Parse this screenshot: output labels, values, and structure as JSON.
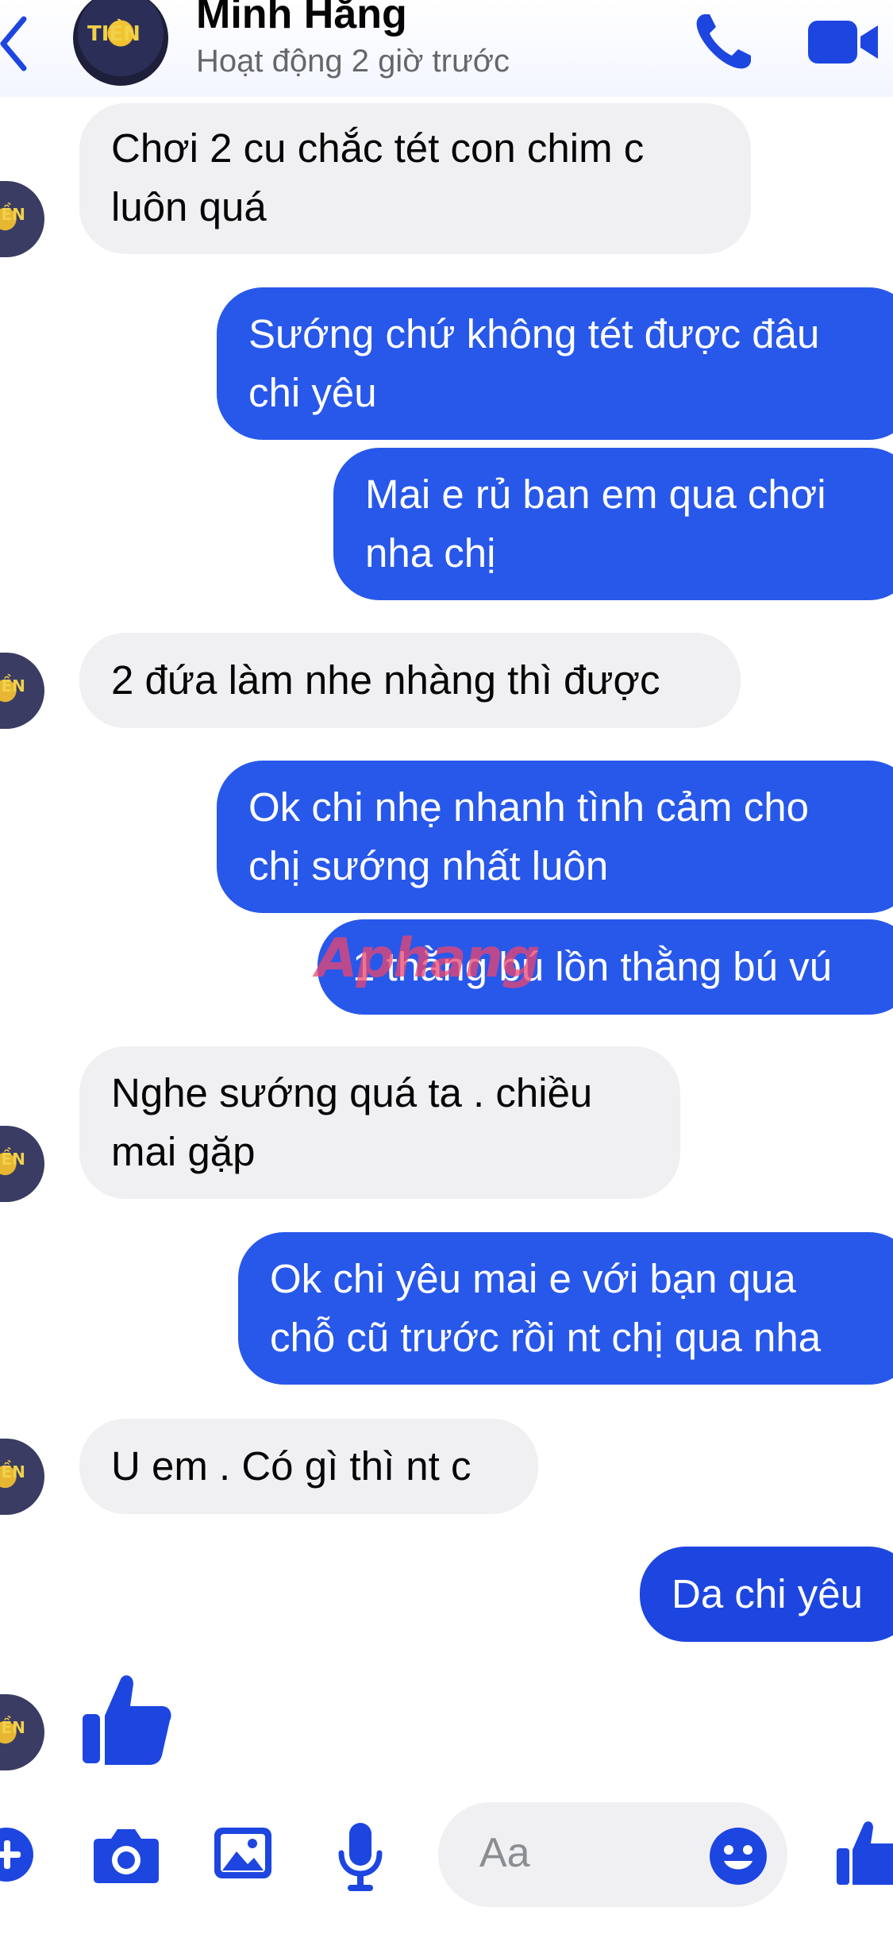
{
  "header": {
    "contact_name": "Minh Hằng",
    "status": "Hoạt động 2 giờ trước",
    "avatar_text": "TIỀN"
  },
  "messages": [
    {
      "dir": "in",
      "lines": [
        "Chơi 2 cu chắc tét con chim c",
        "luôn quá"
      ]
    },
    {
      "dir": "out",
      "lines": [
        "Sướng chứ không tét được đâu",
        "chi yêu"
      ]
    },
    {
      "dir": "out",
      "lines": [
        "Mai e rủ ban em qua chơi",
        "nha chị"
      ]
    },
    {
      "dir": "in",
      "lines": [
        "2 đứa làm nhe nhàng thì được"
      ]
    },
    {
      "dir": "out",
      "lines": [
        "Ok chi nhẹ nhanh tình cảm cho",
        "chị sướng nhất luôn"
      ]
    },
    {
      "dir": "out",
      "lines": [
        "1 thằng bú lồn thằng bú vú"
      ]
    },
    {
      "dir": "in",
      "lines": [
        "Nghe sướng quá ta . chiều",
        "mai gặp"
      ]
    },
    {
      "dir": "out",
      "lines": [
        "Ok chi yêu mai e với bạn qua",
        "chỗ cũ trước rồi nt chị qua nha"
      ]
    },
    {
      "dir": "in",
      "lines": [
        "U em . Có gì thì nt c"
      ]
    },
    {
      "dir": "out",
      "lines": [
        "Da chi yêu"
      ]
    }
  ],
  "watermark": {
    "part1": "Aphang",
    "part2": ""
  },
  "composer": {
    "placeholder": "Aa"
  },
  "icons": {
    "back": "chevron-left-icon",
    "call": "phone-icon",
    "video": "video-camera-icon",
    "plus": "plus-circle-icon",
    "camera": "camera-icon",
    "gallery": "photo-gallery-icon",
    "mic": "microphone-icon",
    "emoji": "smiley-icon",
    "like": "thumbs-up-icon"
  },
  "colors": {
    "accent": "#1d46e0",
    "outgoing_bubble": "#2858ea",
    "incoming_bubble": "#f0f0f3"
  }
}
